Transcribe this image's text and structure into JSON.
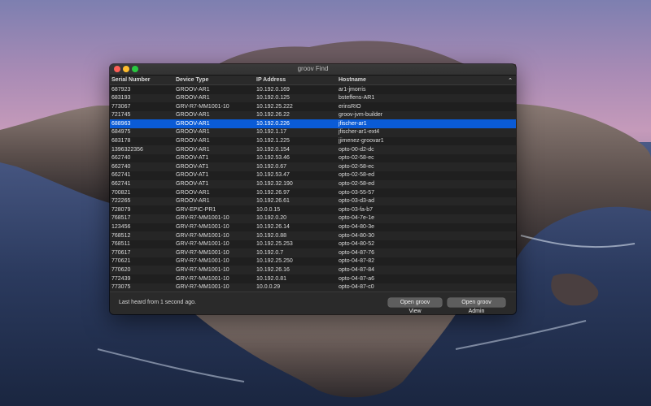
{
  "window": {
    "title": "groov Find"
  },
  "table": {
    "columns": [
      "Serial Number",
      "Device Type",
      "IP Address",
      "Hostname"
    ],
    "sort_indicator": "⌃",
    "selected_index": 4,
    "rows": [
      {
        "serial": "687923",
        "type": "GROOV-AR1",
        "ip": "10.192.0.169",
        "host": "ar1-jmorris"
      },
      {
        "serial": "683193",
        "type": "GROOV-AR1",
        "ip": "10.192.0.125",
        "host": "bsteffens-AR1"
      },
      {
        "serial": "773067",
        "type": "GRV-R7-MM1001-10",
        "ip": "10.192.25.222",
        "host": "erinsRIO"
      },
      {
        "serial": "721745",
        "type": "GROOV-AR1",
        "ip": "10.192.26.22",
        "host": "groov-jvm-builder"
      },
      {
        "serial": "688963",
        "type": "GROOV-AR1",
        "ip": "10.192.0.226",
        "host": "jfischer-ar1"
      },
      {
        "serial": "684975",
        "type": "GROOV-AR1",
        "ip": "10.192.1.17",
        "host": "jfischer-ar1-ext4"
      },
      {
        "serial": "683178",
        "type": "GROOV-AR1",
        "ip": "10.192.1.225",
        "host": "jjimenez-groovar1"
      },
      {
        "serial": "1396322356",
        "type": "GROOV-AR1",
        "ip": "10.192.0.154",
        "host": "opto-00-d2-dc"
      },
      {
        "serial": "662740",
        "type": "GROOV-AT1",
        "ip": "10.192.53.46",
        "host": "opto-02-58-ec"
      },
      {
        "serial": "662740",
        "type": "GROOV-AT1",
        "ip": "10.192.0.67",
        "host": "opto-02-58-ec"
      },
      {
        "serial": "662741",
        "type": "GROOV-AT1",
        "ip": "10.192.53.47",
        "host": "opto-02-58-ed"
      },
      {
        "serial": "662741",
        "type": "GROOV-AT1",
        "ip": "10.192.32.190",
        "host": "opto-02-58-ed"
      },
      {
        "serial": "700821",
        "type": "GROOV-AR1",
        "ip": "10.192.26.97",
        "host": "opto-03-55-57"
      },
      {
        "serial": "722265",
        "type": "GROOV-AR1",
        "ip": "10.192.26.61",
        "host": "opto-03-d3-ad"
      },
      {
        "serial": "728079",
        "type": "GRV-EPIC-PR1",
        "ip": "10.0.0.15",
        "host": "opto-03-fa-b7"
      },
      {
        "serial": "768517",
        "type": "GRV-R7-MM1001-10",
        "ip": "10.192.0.20",
        "host": "opto-04-7e-1e"
      },
      {
        "serial": "123456",
        "type": "GRV-R7-MM1001-10",
        "ip": "10.192.26.14",
        "host": "opto-04-80-3e"
      },
      {
        "serial": "768512",
        "type": "GRV-R7-MM1001-10",
        "ip": "10.192.0.88",
        "host": "opto-04-80-30"
      },
      {
        "serial": "768511",
        "type": "GRV-R7-MM1001-10",
        "ip": "10.192.25.253",
        "host": "opto-04-80-52"
      },
      {
        "serial": "770617",
        "type": "GRV-R7-MM1001-10",
        "ip": "10.192.0.7",
        "host": "opto-04-87-76"
      },
      {
        "serial": "770621",
        "type": "GRV-R7-MM1001-10",
        "ip": "10.192.25.250",
        "host": "opto-04-87-82"
      },
      {
        "serial": "770620",
        "type": "GRV-R7-MM1001-10",
        "ip": "10.192.26.16",
        "host": "opto-04-87-84"
      },
      {
        "serial": "772439",
        "type": "GRV-R7-MM1001-10",
        "ip": "10.192.0.81",
        "host": "opto-04-87-a6"
      },
      {
        "serial": "773075",
        "type": "GRV-R7-MM1001-10",
        "ip": "10.0.0.29",
        "host": "opto-04-87-c0"
      }
    ]
  },
  "footer": {
    "status": "Last heard from 1 second ago.",
    "open_view_label": "Open groov View",
    "open_admin_label": "Open groov Admin"
  },
  "colors": {
    "selection": "#0a5bd6",
    "window_bg": "#1f1f1f"
  }
}
